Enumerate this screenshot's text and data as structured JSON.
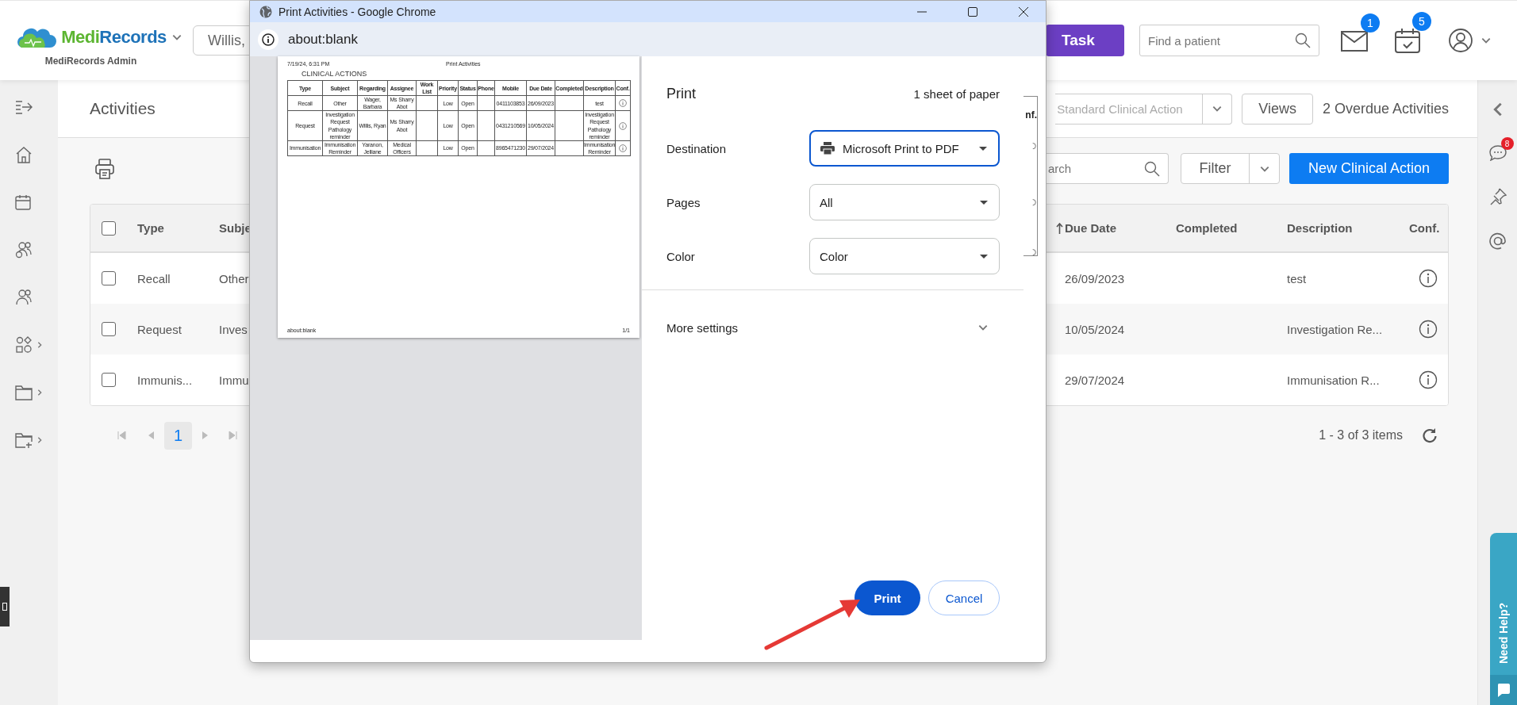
{
  "header": {
    "logo_parts": [
      {
        "text": "Medi",
        "color": "#5cb531"
      },
      {
        "text": "Records",
        "color": "#1d72b8"
      }
    ],
    "subtitle": "MediRecords Admin",
    "patient_field": {
      "value": "Willis,"
    },
    "task_button": "Task",
    "find_patient": {
      "placeholder": "Find a patient"
    },
    "messages_badge": "1",
    "tasks_badge": "5"
  },
  "page": {
    "title": "Activities",
    "action_type": {
      "value": "Standard Clinical Action"
    },
    "views_button": "Views",
    "overdue": "2 Overdue Activities",
    "search": {
      "placeholder": "arch"
    },
    "filter_button": "Filter",
    "new_button": "New Clinical Action"
  },
  "table": {
    "all_checked": false,
    "columns": [
      {
        "label": "Type",
        "sorted": false
      },
      {
        "label": "Subje",
        "sorted": false
      },
      {
        "label": "Due Date",
        "sorted": true
      },
      {
        "label": "Completed",
        "sorted": false
      },
      {
        "label": "Description",
        "sorted": false
      },
      {
        "label": "Conf.",
        "sorted": false
      }
    ],
    "rows": [
      {
        "checked": false,
        "type": "Recall",
        "subject": "Other",
        "due_date": "26/09/2023",
        "description": "test"
      },
      {
        "checked": false,
        "type": "Request",
        "subject": "Inves",
        "due_date": "10/05/2024",
        "description": "Investigation Re..."
      },
      {
        "checked": false,
        "type": "Immunis...",
        "subject": "Immu",
        "due_date": "29/07/2024",
        "description": "Immunisation R..."
      }
    ]
  },
  "pagination": {
    "pages": [
      {
        "label": "1",
        "selected": true
      }
    ],
    "summary": "1 - 3 of 3 items"
  },
  "right_panel": {
    "chat_badge": "8",
    "help_tab": "Need Help?"
  },
  "print_dialog": {
    "title": "Print Activities - Google Chrome",
    "address": "about:blank",
    "preview": {
      "date": "7/19/24, 6:31 PM",
      "doc_title": "Print Activities",
      "heading": "CLINICAL ACTIONS",
      "columns": [
        "Type",
        "Subject",
        "Regarding",
        "Assignee",
        "Work List",
        "Priority",
        "Status",
        "Phone",
        "Mobile",
        "Due Date",
        "Completed",
        "Description",
        "Conf."
      ],
      "rows": [
        {
          "type": "Recall",
          "subject": "Other",
          "regarding": "Wager, Barbara",
          "assignee": "Ms Sharry Abot",
          "priority": "Low",
          "status": "Open",
          "mobile": "0411103853",
          "due_date": "26/09/2023",
          "description": "test"
        },
        {
          "type": "Request",
          "subject": "Investigation Request Pathology reminder",
          "regarding": "Willis, Ryan",
          "assignee": "Ms Sharry Abot",
          "priority": "Low",
          "status": "Open",
          "mobile": "0431210569",
          "due_date": "10/05/2024",
          "description": "Investigation Request Pathology reminder"
        },
        {
          "type": "Immunisation",
          "subject": "Immunisation Reminder",
          "regarding": "Yaranon, Jelliane",
          "assignee": "Medical Officers",
          "priority": "Low",
          "status": "Open",
          "mobile": "8965471230",
          "due_date": "29/07/2024",
          "description": "Immunisation Reminder"
        }
      ],
      "footer_left": "about:blank",
      "footer_right": "1/1"
    },
    "settings": {
      "title": "Print",
      "sheets": "1 sheet of paper",
      "fields": [
        {
          "label": "Destination",
          "value": "Microsoft Print to PDF",
          "focused": true,
          "kind": "printer"
        },
        {
          "label": "Pages",
          "value": "All",
          "focused": false,
          "kind": "plain"
        },
        {
          "label": "Color",
          "value": "Color",
          "focused": false,
          "kind": "plain"
        }
      ],
      "more_settings": "More settings",
      "print_button": "Print",
      "cancel_button": "Cancel"
    }
  },
  "behind_fragment": {
    "header": "nf."
  }
}
